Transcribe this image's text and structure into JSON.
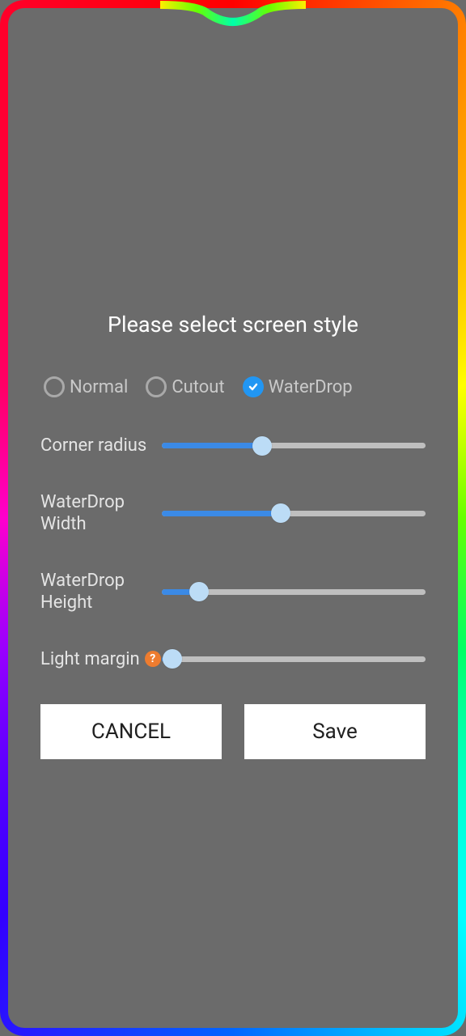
{
  "title": "Please select screen style",
  "radios": {
    "normal": {
      "label": "Normal",
      "selected": false
    },
    "cutout": {
      "label": "Cutout",
      "selected": false
    },
    "waterdrop": {
      "label": "WaterDrop",
      "selected": true
    }
  },
  "sliders": {
    "corner_radius": {
      "label": "Corner radius",
      "value": 38
    },
    "waterdrop_width": {
      "label": "WaterDrop Width",
      "value": 45
    },
    "waterdrop_height": {
      "label": "WaterDrop Height",
      "value": 14
    },
    "light_margin": {
      "label": "Light margin",
      "value": 4,
      "help": "?"
    }
  },
  "buttons": {
    "cancel": "CANCEL",
    "save": "Save"
  },
  "colors": {
    "accent": "#2196f3",
    "slider_fill": "#3b8ae6",
    "thumb": "#bcdcf6",
    "help_bg": "#ee7c2f"
  }
}
